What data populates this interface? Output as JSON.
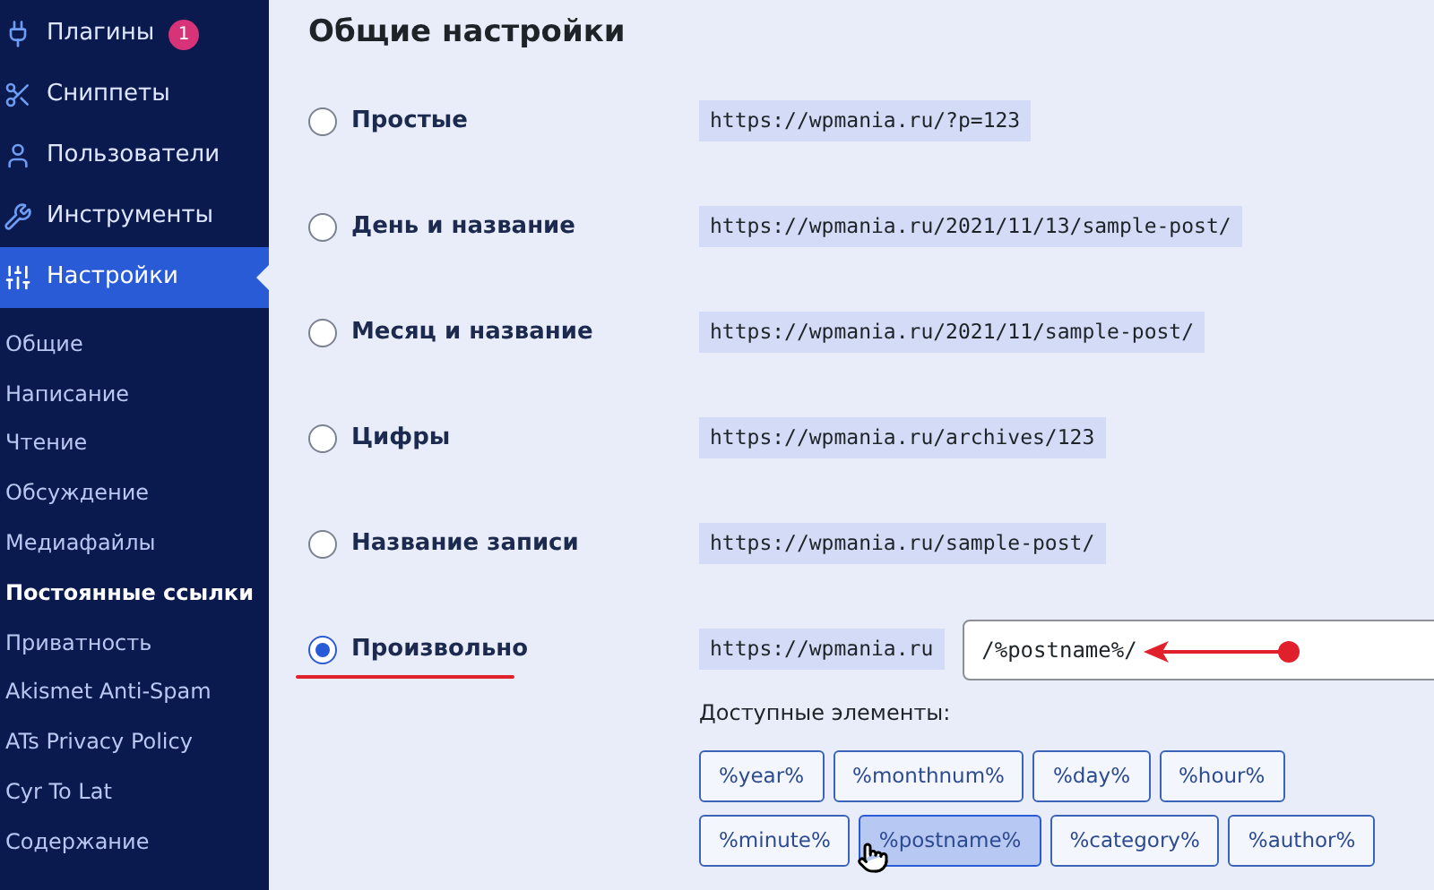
{
  "sidebar": {
    "menu": [
      {
        "label": "Плагины",
        "badge": "1",
        "selected": false
      },
      {
        "label": "Сниппеты",
        "selected": false
      },
      {
        "label": "Пользователи",
        "selected": false
      },
      {
        "label": "Инструменты",
        "selected": false
      },
      {
        "label": "Настройки",
        "selected": true
      }
    ],
    "submenu": [
      {
        "label": "Общие",
        "selected": false
      },
      {
        "label": "Написание",
        "selected": false
      },
      {
        "label": "Чтение",
        "selected": false
      },
      {
        "label": "Обсуждение",
        "selected": false
      },
      {
        "label": "Медиафайлы",
        "selected": false
      },
      {
        "label": "Постоянные ссылки",
        "selected": true
      },
      {
        "label": "Приватность",
        "selected": false
      },
      {
        "label": "Akismet Anti-Spam",
        "selected": false
      },
      {
        "label": "ATs Privacy Policy",
        "selected": false
      },
      {
        "label": "Cyr To Lat",
        "selected": false
      },
      {
        "label": "Содержание",
        "selected": false
      }
    ]
  },
  "main": {
    "title": "Общие настройки",
    "options": [
      {
        "label": "Простые",
        "url": "https://wpmania.ru/?p=123",
        "selected": false
      },
      {
        "label": "День и название",
        "url": "https://wpmania.ru/2021/11/13/sample-post/",
        "selected": false
      },
      {
        "label": "Месяц и название",
        "url": "https://wpmania.ru/2021/11/sample-post/",
        "selected": false
      },
      {
        "label": "Цифры",
        "url": "https://wpmania.ru/archives/123",
        "selected": false
      },
      {
        "label": "Название записи",
        "url": "https://wpmania.ru/sample-post/",
        "selected": false
      },
      {
        "label": "Произвольно",
        "url": "https://wpmania.ru",
        "value": "/%postname%/",
        "selected": true
      }
    ],
    "tags_label": "Доступные элементы:",
    "tags": [
      {
        "label": "%year%",
        "selected": false
      },
      {
        "label": "%monthnum%",
        "selected": false
      },
      {
        "label": "%day%",
        "selected": false
      },
      {
        "label": "%hour%",
        "selected": false
      },
      {
        "label": "%minute%",
        "selected": false
      },
      {
        "label": "%postname%",
        "selected": true
      },
      {
        "label": "%category%",
        "selected": false
      },
      {
        "label": "%author%",
        "selected": false
      }
    ]
  }
}
